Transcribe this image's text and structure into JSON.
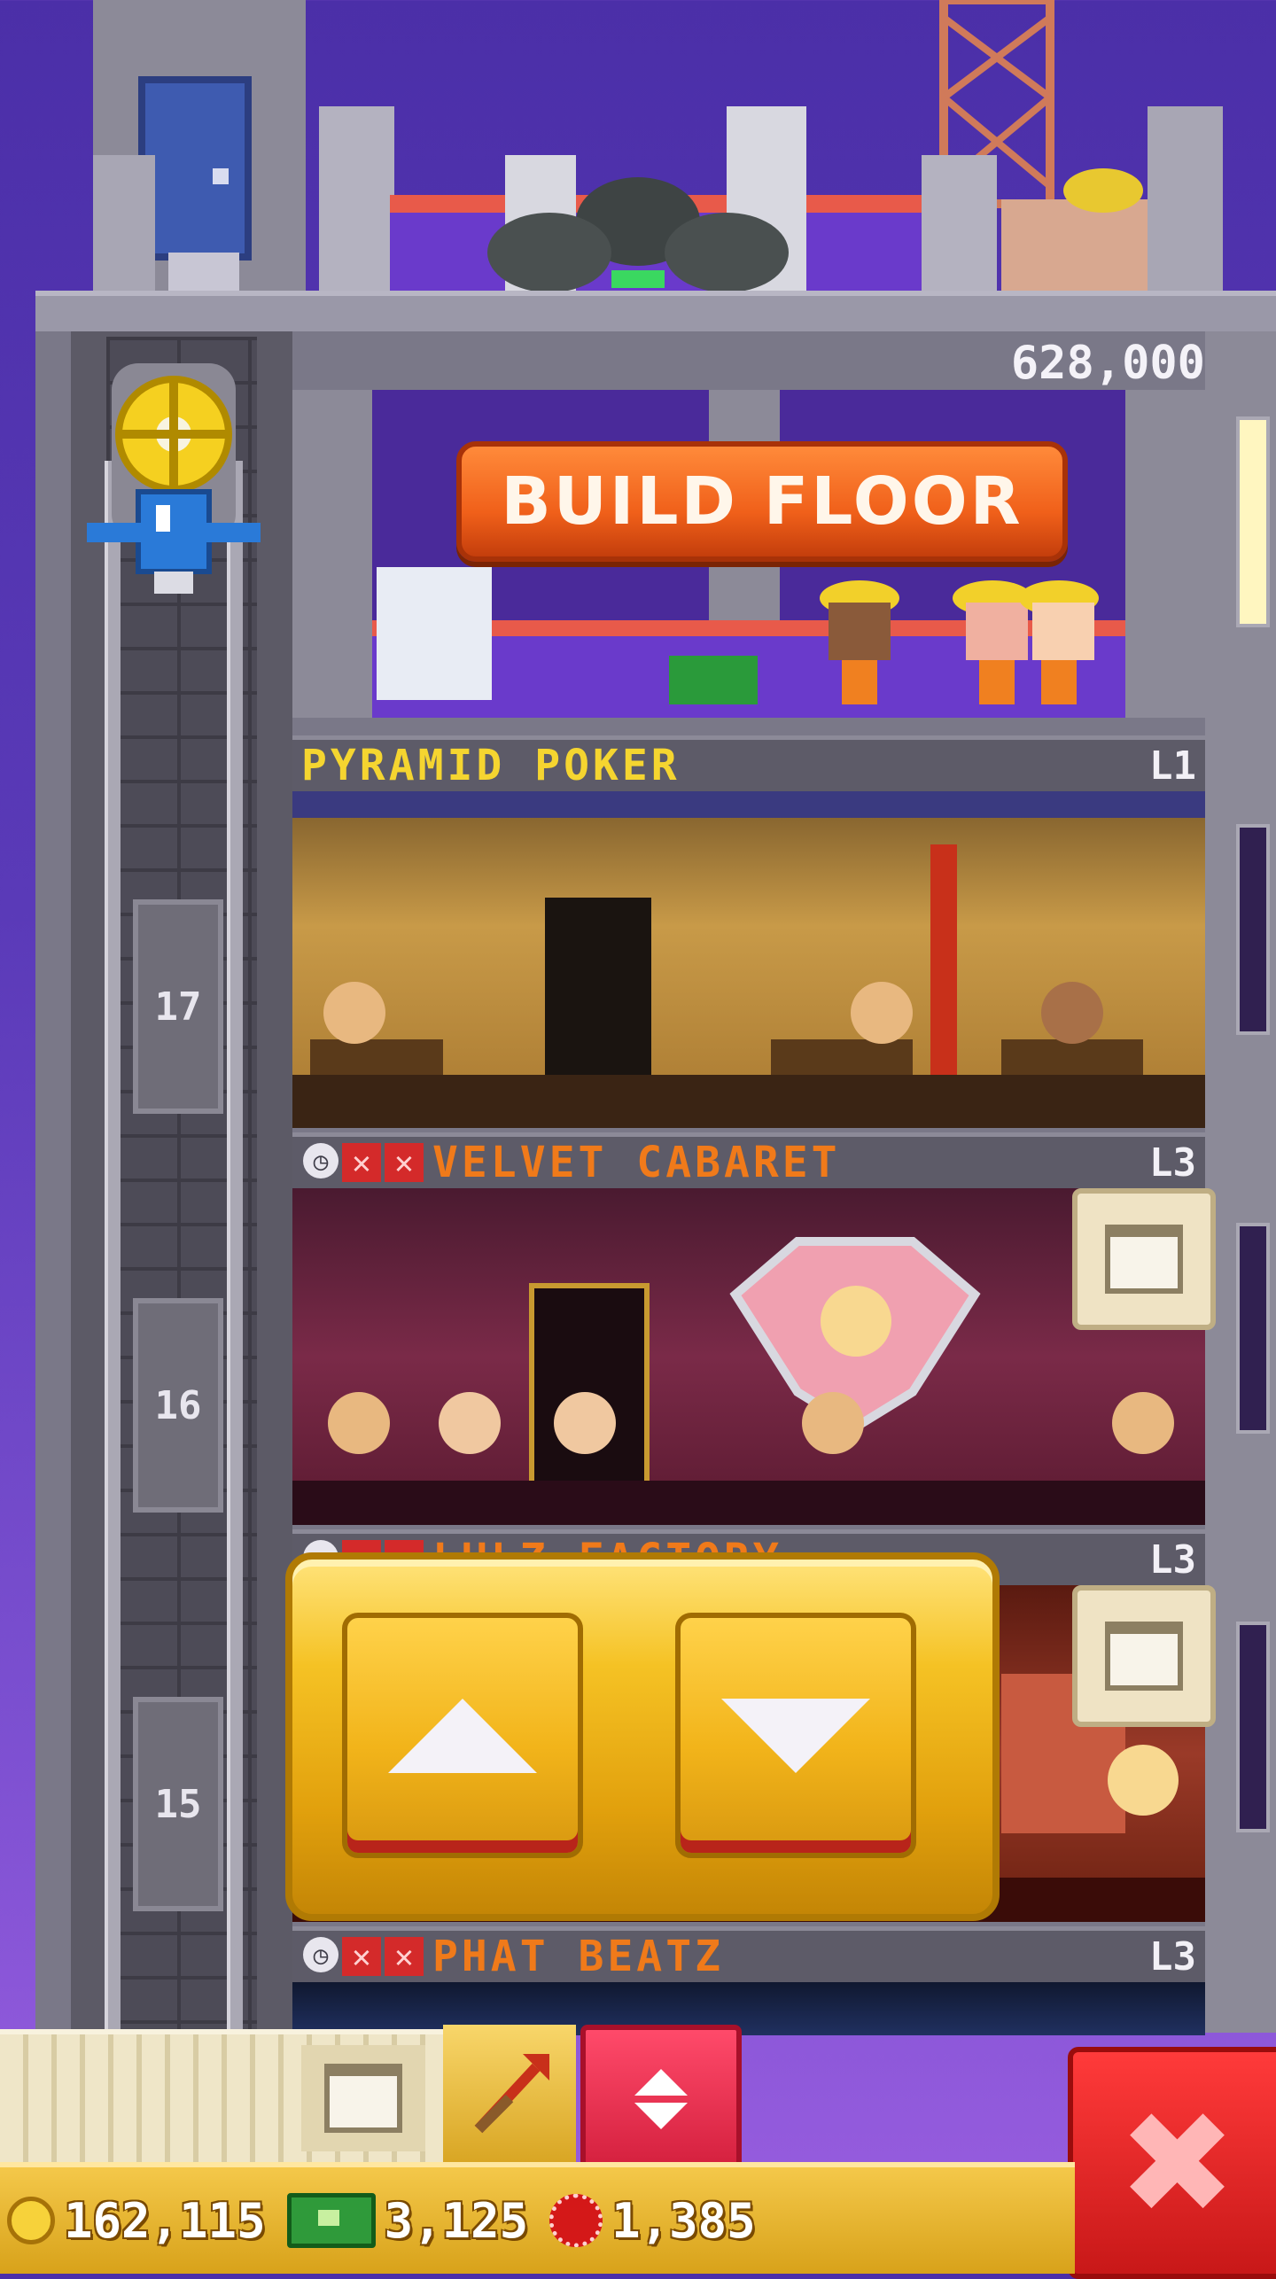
{
  "header": {
    "floor_cost": "628,000"
  },
  "build_floor": {
    "label": "BUILD FLOOR"
  },
  "floors": [
    {
      "name": "PYRAMID POKER",
      "level": "L1",
      "number": "",
      "name_color": "#f5d530",
      "has_status": false
    },
    {
      "name": "VELVET CABARET",
      "level": "L3",
      "number": "17",
      "name_color": "#f07a1a",
      "has_status": true
    },
    {
      "name": "LULZ FACTORY",
      "level": "L3",
      "number": "16",
      "name_color": "#f07a1a",
      "has_status": true
    },
    {
      "name": "PHAT BEATZ",
      "level": "L3",
      "number": "15",
      "name_color": "#f07a1a",
      "has_status": true
    }
  ],
  "shaft_numbers": [
    "17",
    "16",
    "15"
  ],
  "lift_controls": {
    "up": "up-arrow-icon",
    "down": "down-arrow-icon"
  },
  "toolbar": {
    "hammer": "hammer-icon",
    "elevator": "elevator-updown-icon",
    "close": "✖"
  },
  "status": {
    "coins": "162,115",
    "bux": "3,125",
    "chips": "1,385"
  },
  "colors": {
    "sky": "#5a3ab8",
    "build_button": "#f0601a",
    "lift_panel": "#f5c224",
    "close_button": "#d42020",
    "status_bar": "#e8b22a"
  }
}
